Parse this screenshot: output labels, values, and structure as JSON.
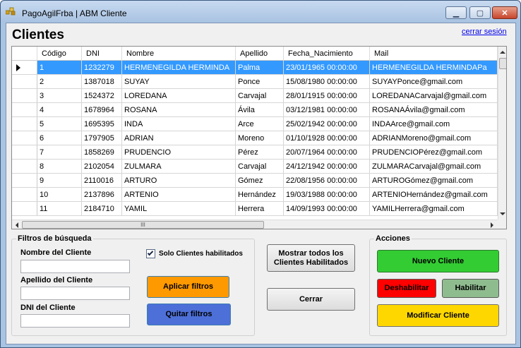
{
  "window": {
    "title": "PagoAgilFrba | ABM Cliente",
    "minimize": "▁",
    "maximize": "▢",
    "close": "✕"
  },
  "page": {
    "title": "Clientes",
    "logout_link": "cerrar sesión"
  },
  "grid": {
    "columns": [
      "Código",
      "DNI",
      "Nombre",
      "Apellido",
      "Fecha_Nacimiento",
      "Mail"
    ],
    "rows": [
      [
        "1",
        "1232279",
        "HERMENEGILDA   HERMINDA",
        "Palma",
        "23/01/1965 00:00:00",
        "HERMENEGILDA   HERMINDAPa"
      ],
      [
        "2",
        "1387018",
        "SUYAY",
        "Ponce",
        "15/08/1980 00:00:00",
        "SUYAYPonce@gmail.com"
      ],
      [
        "3",
        "1524372",
        "LOREDANA",
        "Carvajal",
        "28/01/1915 00:00:00",
        "LOREDANACarvajal@gmail.com"
      ],
      [
        "4",
        "1678964",
        "ROSANA",
        "Ávila",
        "03/12/1981 00:00:00",
        "ROSANAÁvila@gmail.com"
      ],
      [
        "5",
        "1695395",
        "INDA",
        "Arce",
        "25/02/1942 00:00:00",
        "INDAArce@gmail.com"
      ],
      [
        "6",
        "1797905",
        "ADRIAN",
        "Moreno",
        "01/10/1928 00:00:00",
        "ADRIANMoreno@gmail.com"
      ],
      [
        "7",
        "1858269",
        "PRUDENCIO",
        "Pérez",
        "20/07/1964 00:00:00",
        "PRUDENCIOPérez@gmail.com"
      ],
      [
        "8",
        "2102054",
        "ZULMARA",
        "Carvajal",
        "24/12/1942 00:00:00",
        "ZULMARACarvajal@gmail.com"
      ],
      [
        "9",
        "2110016",
        "ARTURO",
        "Gómez",
        "22/08/1956 00:00:00",
        "ARTUROGómez@gmail.com"
      ],
      [
        "10",
        "2137896",
        "ARTENIO",
        "Hernández",
        "19/03/1988 00:00:00",
        "ARTENIOHernández@gmail.com"
      ],
      [
        "11",
        "2184710",
        "YAMIL",
        "Herrera",
        "14/09/1993 00:00:00",
        "YAMILHerrera@gmail.com"
      ]
    ],
    "selected_row": 0,
    "scroll_grip": "III"
  },
  "filters": {
    "title": "Filtros de búsqueda",
    "name_label": "Nombre del Cliente",
    "name_value": "",
    "lastname_label": "Apellido del Cliente",
    "lastname_value": "",
    "dni_label": "DNI del Cliente",
    "dni_value": "",
    "only_enabled_label": "Solo Clientes habilitados",
    "only_enabled_checked": true,
    "apply_label": "Aplicar filtros",
    "clear_label": "Quitar filtros"
  },
  "middle": {
    "show_all_label": "Mostrar todos los Clientes Habilitados",
    "close_label": "Cerrar"
  },
  "actions": {
    "title": "Acciones",
    "new_label": "Nuevo Cliente",
    "disable_label": "Deshabilitar",
    "enable_label": "Habilitar",
    "modify_label": "Modificar Cliente"
  },
  "colors": {
    "selection": "#3399ff",
    "apply": "#ff9900",
    "clear": "#4d6fd8",
    "new": "#33cc33",
    "disable": "#ff0000",
    "enable": "#8fbc8f",
    "modify": "#ffd700"
  }
}
